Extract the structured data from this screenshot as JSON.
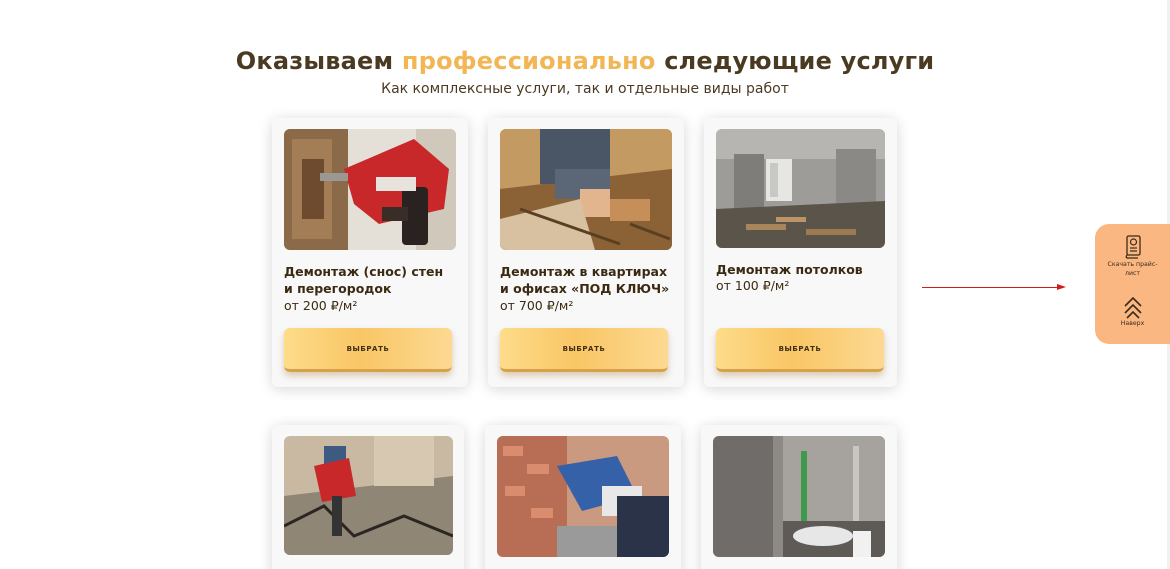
{
  "heading": {
    "before": "Оказываем",
    "accent": "профессионально",
    "after": "следующие услуги",
    "subtitle": "Как комплексные услуги, так и отдельные виды работ"
  },
  "services": [
    {
      "title_line1": "Демонтаж (снос) стен",
      "title_line2": "и перегородок",
      "price": "от 200 ₽/м²",
      "button": "ВЫБРАТЬ"
    },
    {
      "title_line1": "Демонтаж в квартирах",
      "title_line2": "и офисах «ПОД КЛЮЧ»",
      "price": "от 700 ₽/м²",
      "button": "ВЫБРАТЬ"
    },
    {
      "title_line1": "Демонтаж потолков",
      "title_line2": "",
      "price": "от 100 ₽/м²",
      "button": "ВЫБРАТЬ"
    }
  ],
  "side_widget": {
    "price_list_label": "Скачать прайс-лист",
    "top_label": "Наверх",
    "price_list_icon": "document-download-icon",
    "top_icon": "double-chevron-up-icon"
  },
  "colors": {
    "accent": "#f2b655",
    "button": "#f9c665",
    "widget": "#fbb782",
    "arrow": "#d31b1b",
    "text": "#3b2a12"
  }
}
